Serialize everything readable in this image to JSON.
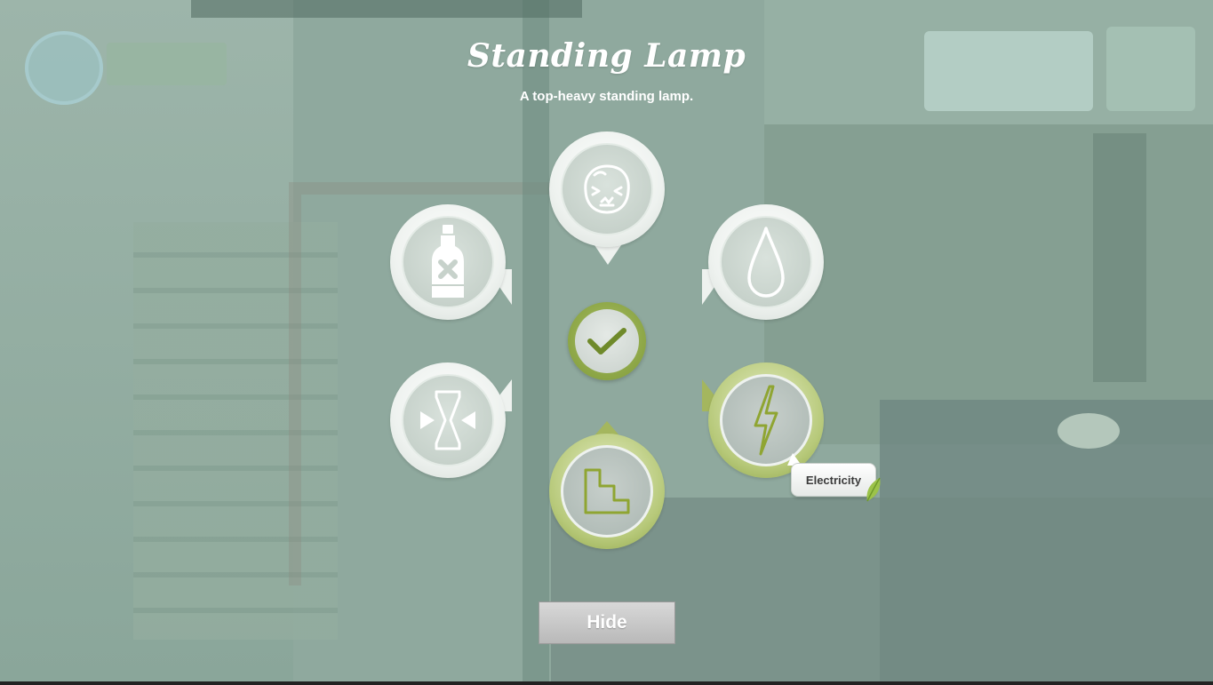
{
  "item": {
    "title": "Standing Lamp",
    "description": "A top-heavy standing lamp."
  },
  "wheel": {
    "nodes": [
      {
        "id": "nuisance",
        "icon": "crying-face-icon",
        "state": "idle"
      },
      {
        "id": "poison",
        "icon": "poison-bottle-icon",
        "state": "idle"
      },
      {
        "id": "water",
        "icon": "water-drop-icon",
        "state": "idle"
      },
      {
        "id": "squeeze",
        "icon": "squeeze-arrows-icon",
        "state": "idle"
      },
      {
        "id": "electricity",
        "icon": "lightning-bolt-icon",
        "state": "active"
      },
      {
        "id": "stairs",
        "icon": "stairs-icon",
        "state": "active"
      }
    ],
    "center": {
      "icon": "checkmark-icon"
    }
  },
  "tooltip": {
    "label": "Electricity"
  },
  "buttons": {
    "hide_label": "Hide"
  },
  "colors": {
    "accent_green": "#8da346",
    "icon_green": "#8fa532",
    "icon_white": "#ffffff"
  }
}
